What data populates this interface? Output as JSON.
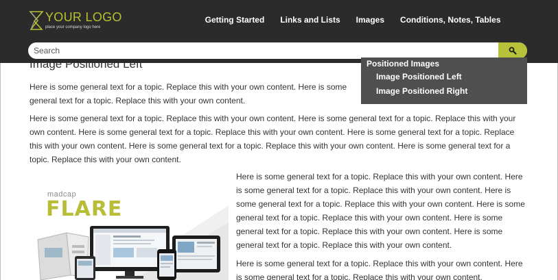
{
  "header": {
    "logo_text": "YOUR LOGO",
    "logo_tagline": "place your company logo here",
    "nav": [
      {
        "label": "Getting Started"
      },
      {
        "label": "Links and Lists"
      },
      {
        "label": "Images"
      },
      {
        "label": "Conditions, Notes, Tables"
      }
    ],
    "search_placeholder": "Search",
    "search_icon": "search-icon"
  },
  "dropdown": {
    "heading": "Positioned Images",
    "items": [
      {
        "label": "Image Positioned Left"
      },
      {
        "label": "Image Positioned Right"
      }
    ]
  },
  "main": {
    "title": "Image Positioned Left",
    "paragraphs": [
      "Here is some general text for a topic. Replace this with your own content. Here is some general text for a topic. Replace this with your own content.",
      "Here is some general text for a topic. Replace this with your own content. Here is some general text for a topic. Replace this with your own content. Here is some general text for a topic. Replace this with your own content. Here is some general text for a topic. Replace this with your own content. Here is some general text for a topic. Replace this with your own content. Here is some general text for a topic. Replace this with your own content.",
      "Here is some general text for a topic. Replace this with your own content. Here is some general text for a topic. Replace this with your own content. Here is some general text for a topic. Replace this with your own content. Here is some general text for a topic. Replace this with your own content. Here is some general text for a topic. Replace this with your own content. Here is some general text for a topic. Replace this with your own content.",
      "Here is some general text for a topic. Replace this with your own content. Here is some general text for a topic. Replace this with your own content."
    ],
    "image": {
      "brand_small": "madcap",
      "brand_large": "FLARE"
    }
  },
  "colors": {
    "header_bg": "#2b2b2b",
    "accent": "#b7c23a",
    "dropdown_bg": "#4f4f4f"
  }
}
